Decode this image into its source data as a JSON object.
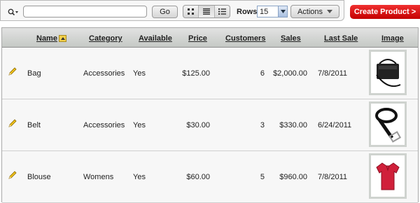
{
  "toolbar": {
    "search_value": "",
    "go_label": "Go",
    "rows_label": "Rows",
    "rows_value": "15",
    "actions_label": "Actions",
    "create_label": "Create Product >"
  },
  "table": {
    "columns": [
      "Name",
      "Category",
      "Available",
      "Price",
      "Customers",
      "Sales",
      "Last Sale",
      "Image"
    ],
    "rows": [
      {
        "name": "Bag",
        "category": "Accessories",
        "available": "Yes",
        "price": "$125.00",
        "customers": "6",
        "sales": "$2,000.00",
        "last_sale": "7/8/2011",
        "image": "bag-image"
      },
      {
        "name": "Belt",
        "category": "Accessories",
        "available": "Yes",
        "price": "$30.00",
        "customers": "3",
        "sales": "$330.00",
        "last_sale": "6/24/2011",
        "image": "belt-image"
      },
      {
        "name": "Blouse",
        "category": "Womens",
        "available": "Yes",
        "price": "$60.00",
        "customers": "5",
        "sales": "$960.00",
        "last_sale": "7/8/2011",
        "image": "blouse-image"
      }
    ]
  },
  "colors": {
    "create_button": "#d90000",
    "header_bg": "#d2d5d2",
    "row_bg": "#f7f7f7"
  }
}
